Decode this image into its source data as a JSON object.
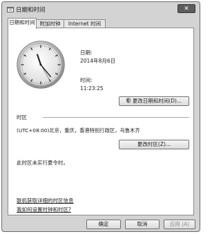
{
  "window": {
    "title": "日期和时间",
    "close_label": "✕"
  },
  "tabs": [
    {
      "label": "日期和时间",
      "active": true
    },
    {
      "label": "附加时钟",
      "active": false
    },
    {
      "label": "Internet 时间",
      "active": false
    }
  ],
  "clock": {
    "hour": 11,
    "minute": 23,
    "second": 25
  },
  "date": {
    "label": "日期:",
    "value": "2014年8月6日"
  },
  "time": {
    "label": "时间:",
    "value": "11:23:25"
  },
  "change_datetime_button": "更改日期和时间(D)...",
  "timezone": {
    "section_label": "时区",
    "value": "(UTC+08:00)北京，重庆，香港特别行政区，乌鲁木齐",
    "change_button": "更改时区(Z)...",
    "dst_note": "此时区未实行夏令时。"
  },
  "links": {
    "online_info": "联机获取详细的时区信息",
    "how_to_set": "我如何设置时钟和时区?"
  },
  "footer": {
    "ok": "确定",
    "cancel": "取消",
    "apply": "应用 (A)"
  }
}
